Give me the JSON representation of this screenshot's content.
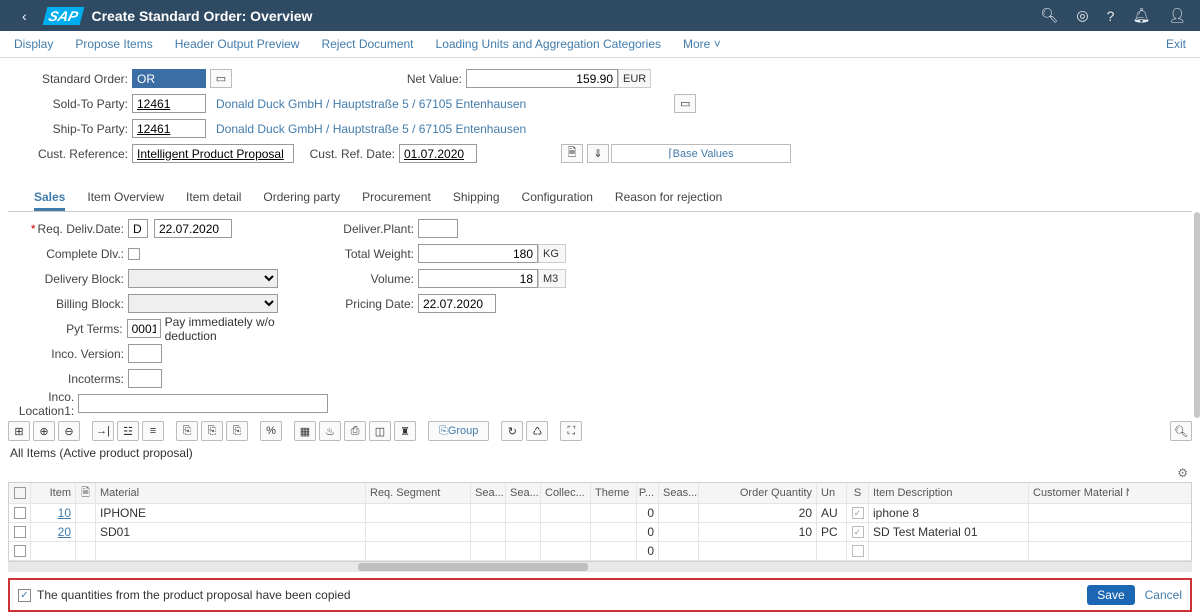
{
  "header": {
    "title": "Create Standard Order: Overview"
  },
  "menubar": {
    "display": "Display",
    "propose": "Propose Items",
    "output": "Header Output Preview",
    "reject": "Reject Document",
    "loading": "Loading Units and Aggregation Categories",
    "more": "More",
    "exit": "Exit"
  },
  "form": {
    "std_order_l": "Standard Order:",
    "std_order_v": "OR",
    "net_value_l": "Net Value:",
    "net_value_v": "159.90",
    "net_value_u": "EUR",
    "sold_to_l": "Sold-To Party:",
    "sold_to_v": "12461",
    "sold_to_name": "Donald Duck GmbH / Hauptstraße 5 / 67105 Entenhausen",
    "ship_to_l": "Ship-To Party:",
    "ship_to_v": "12461",
    "ship_to_name": "Donald Duck GmbH / Hauptstraße 5 / 67105 Entenhausen",
    "cust_ref_l": "Cust. Reference:",
    "cust_ref_v": "Intelligent Product Proposal",
    "cust_ref_date_l": "Cust. Ref. Date:",
    "cust_ref_date_v": "01.07.2020",
    "base_values": "Base Values"
  },
  "tabs": {
    "sales": "Sales",
    "itm_ov": "Item Overview",
    "itm_dt": "Item detail",
    "ord": "Ordering party",
    "proc": "Procurement",
    "ship": "Shipping",
    "conf": "Configuration",
    "rej": "Reason for rejection"
  },
  "details": {
    "req_deliv_l": "Req. Deliv.Date:",
    "req_deliv_code": "D",
    "req_deliv_v": "22.07.2020",
    "complete_l": "Complete Dlv.:",
    "deliv_block_l": "Delivery Block:",
    "bill_block_l": "Billing Block:",
    "pyt_terms_l": "Pyt Terms:",
    "pyt_terms_code": "0001",
    "pyt_terms_desc": "Pay immediately w/o deduction",
    "inco_ver_l": "Inco. Version:",
    "inco_l": "Incoterms:",
    "inco_loc_l": "Inco. Location1:",
    "deliv_plant_l": "Deliver.Plant:",
    "tot_weight_l": "Total Weight:",
    "tot_weight_v": "180",
    "tot_weight_u": "KG",
    "volume_l": "Volume:",
    "volume_v": "18",
    "volume_u": "M3",
    "pricing_l": "Pricing Date:",
    "pricing_v": "22.07.2020"
  },
  "tbar": {
    "group": "Group"
  },
  "subtitle": "All Items (Active product proposal)",
  "thead": {
    "item": "Item",
    "mat": "Material",
    "seg": "Req. Segment",
    "sea1": "Sea...",
    "sea2": "Sea...",
    "col": "Collec...",
    "thm": "Theme",
    "p": "P...",
    "seas": "Seas...",
    "qty": "Order Quantity",
    "un": "Un",
    "s": "S",
    "desc": "Item Description",
    "cmn": "Customer Material Numl"
  },
  "rows": [
    {
      "item": "10",
      "mat": "IPHONE",
      "p": "0",
      "qty": "20",
      "un": "AU",
      "s": "✓",
      "desc": "iphone 8"
    },
    {
      "item": "20",
      "mat": "SD01",
      "p": "0",
      "qty": "10",
      "un": "PC",
      "s": "✓",
      "desc": "SD Test Material 01"
    },
    {
      "item": "",
      "mat": "",
      "p": "0",
      "qty": "",
      "un": "",
      "s": "",
      "desc": ""
    }
  ],
  "footer": {
    "msg": "The quantities from the product proposal have been copied",
    "save": "Save",
    "cancel": "Cancel"
  }
}
